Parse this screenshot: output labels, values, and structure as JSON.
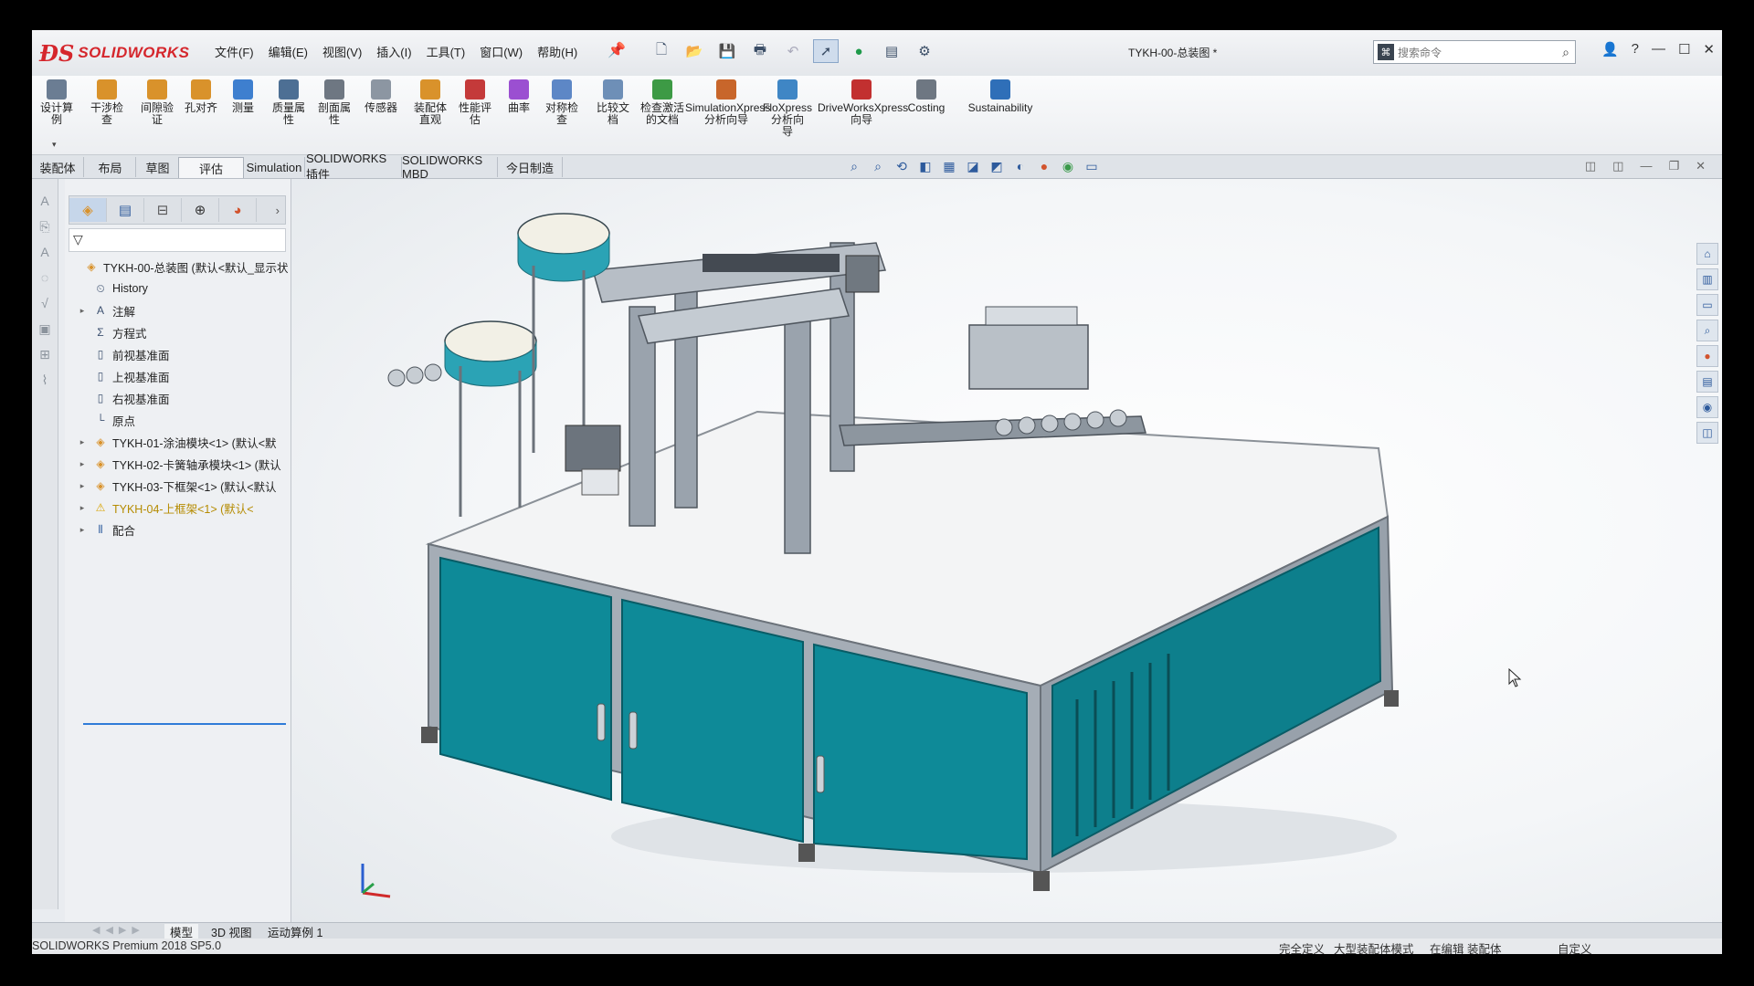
{
  "window": {
    "title": "TYKH-00-总装图 *",
    "app_logo": "SOLIDWORKS"
  },
  "menu": [
    "文件(F)",
    "编辑(E)",
    "视图(V)",
    "插入(I)",
    "工具(T)",
    "窗口(W)",
    "帮助(H)"
  ],
  "search": {
    "placeholder": "搜索命令"
  },
  "toolbar": [
    {
      "label": "设计算\n例",
      "icon": "design-study-icon",
      "color": "#6b7d93"
    },
    {
      "label": "干涉检\n查",
      "icon": "interference-icon",
      "color": "#d9922b"
    },
    {
      "label": "间隙验\n证",
      "icon": "clearance-icon",
      "color": "#d9922b"
    },
    {
      "label": "孔对齐",
      "icon": "hole-alignment-icon",
      "color": "#d9922b"
    },
    {
      "label": "测量",
      "icon": "measure-icon",
      "color": "#3e7fcf"
    },
    {
      "label": "质量属\n性",
      "icon": "mass-properties-icon",
      "color": "#4d6f94"
    },
    {
      "label": "剖面属\n性",
      "icon": "section-properties-icon",
      "color": "#6e7782"
    },
    {
      "label": "传感器",
      "icon": "sensor-icon",
      "color": "#8c96a2"
    },
    {
      "label": "装配体\n直观",
      "icon": "assembly-visualization-icon",
      "color": "#d9922b"
    },
    {
      "label": "性能评\n估",
      "icon": "performance-evaluation-icon",
      "color": "#c43a3a"
    },
    {
      "label": "曲率",
      "icon": "curvature-icon",
      "color": "#9b4fd1"
    },
    {
      "label": "对称检\n查",
      "icon": "symmetry-check-icon",
      "color": "#5d87c6"
    },
    {
      "label": "比较文\n档",
      "icon": "compare-documents-icon",
      "color": "#6e8fb7"
    },
    {
      "label": "检查激活\n的文档",
      "icon": "check-active-document-icon",
      "color": "#3d9a45"
    },
    {
      "label": "SimulationXpress\n分析向导",
      "icon": "simulationxpress-icon",
      "color": "#c8662b"
    },
    {
      "label": "FloXpress\n分析向\n导",
      "icon": "floxpress-icon",
      "color": "#3f86c5"
    },
    {
      "label": "DriveWorksXpress\n向导",
      "icon": "driveworksxpress-icon",
      "color": "#c23030"
    },
    {
      "label": "Costing",
      "icon": "costing-icon",
      "color": "#6e7782"
    },
    {
      "label": "Sustainability",
      "icon": "sustainability-icon",
      "color": "#2f6fb8"
    }
  ],
  "tabs": [
    "装配体",
    "布局",
    "草图",
    "评估",
    "Simulation",
    "SOLIDWORKS 插件",
    "SOLIDWORKS MBD",
    "今日制造"
  ],
  "active_tab": "评估",
  "tree": [
    {
      "label": "TYKH-00-总装图 (默认<默认_显示状",
      "icon": "assembly-icon",
      "expand": "",
      "indent": 0
    },
    {
      "label": "History",
      "icon": "history-icon",
      "expand": "",
      "indent": 1
    },
    {
      "label": "注解",
      "icon": "annotations-icon",
      "expand": "▸",
      "indent": 1
    },
    {
      "label": "方程式",
      "icon": "equations-icon",
      "expand": "",
      "indent": 1
    },
    {
      "label": "前视基准面",
      "icon": "plane-icon",
      "expand": "",
      "indent": 1
    },
    {
      "label": "上视基准面",
      "icon": "plane-icon",
      "expand": "",
      "indent": 1
    },
    {
      "label": "右视基准面",
      "icon": "plane-icon",
      "expand": "",
      "indent": 1
    },
    {
      "label": "原点",
      "icon": "origin-icon",
      "expand": "",
      "indent": 1
    },
    {
      "label": "TYKH-01-涂油模块<1> (默认<默",
      "icon": "subassembly-icon",
      "expand": "▸",
      "indent": 1
    },
    {
      "label": "TYKH-02-卡簧轴承模块<1> (默认",
      "icon": "subassembly-icon",
      "expand": "▸",
      "indent": 1
    },
    {
      "label": "TYKH-03-下框架<1> (默认<默认",
      "icon": "subassembly-icon",
      "expand": "▸",
      "indent": 1
    },
    {
      "label": "TYKH-04-上框架<1> (默认<",
      "icon": "warning-icon",
      "expand": "▸",
      "indent": 1,
      "warn": true
    },
    {
      "label": "配合",
      "icon": "mates-icon",
      "expand": "▸",
      "indent": 1
    }
  ],
  "bottom_tabs": [
    "模型",
    "3D 视图",
    "运动算例 1"
  ],
  "status": {
    "product": "SOLIDWORKS Premium 2018 SP5.0",
    "state": "完全定义",
    "mode": "大型装配体模式",
    "editing": "在编辑 装配体",
    "units": "自定义"
  },
  "colors": {
    "accent": "#2f7bd8",
    "panel": "#0e8a98",
    "brand": "#d5262c"
  }
}
